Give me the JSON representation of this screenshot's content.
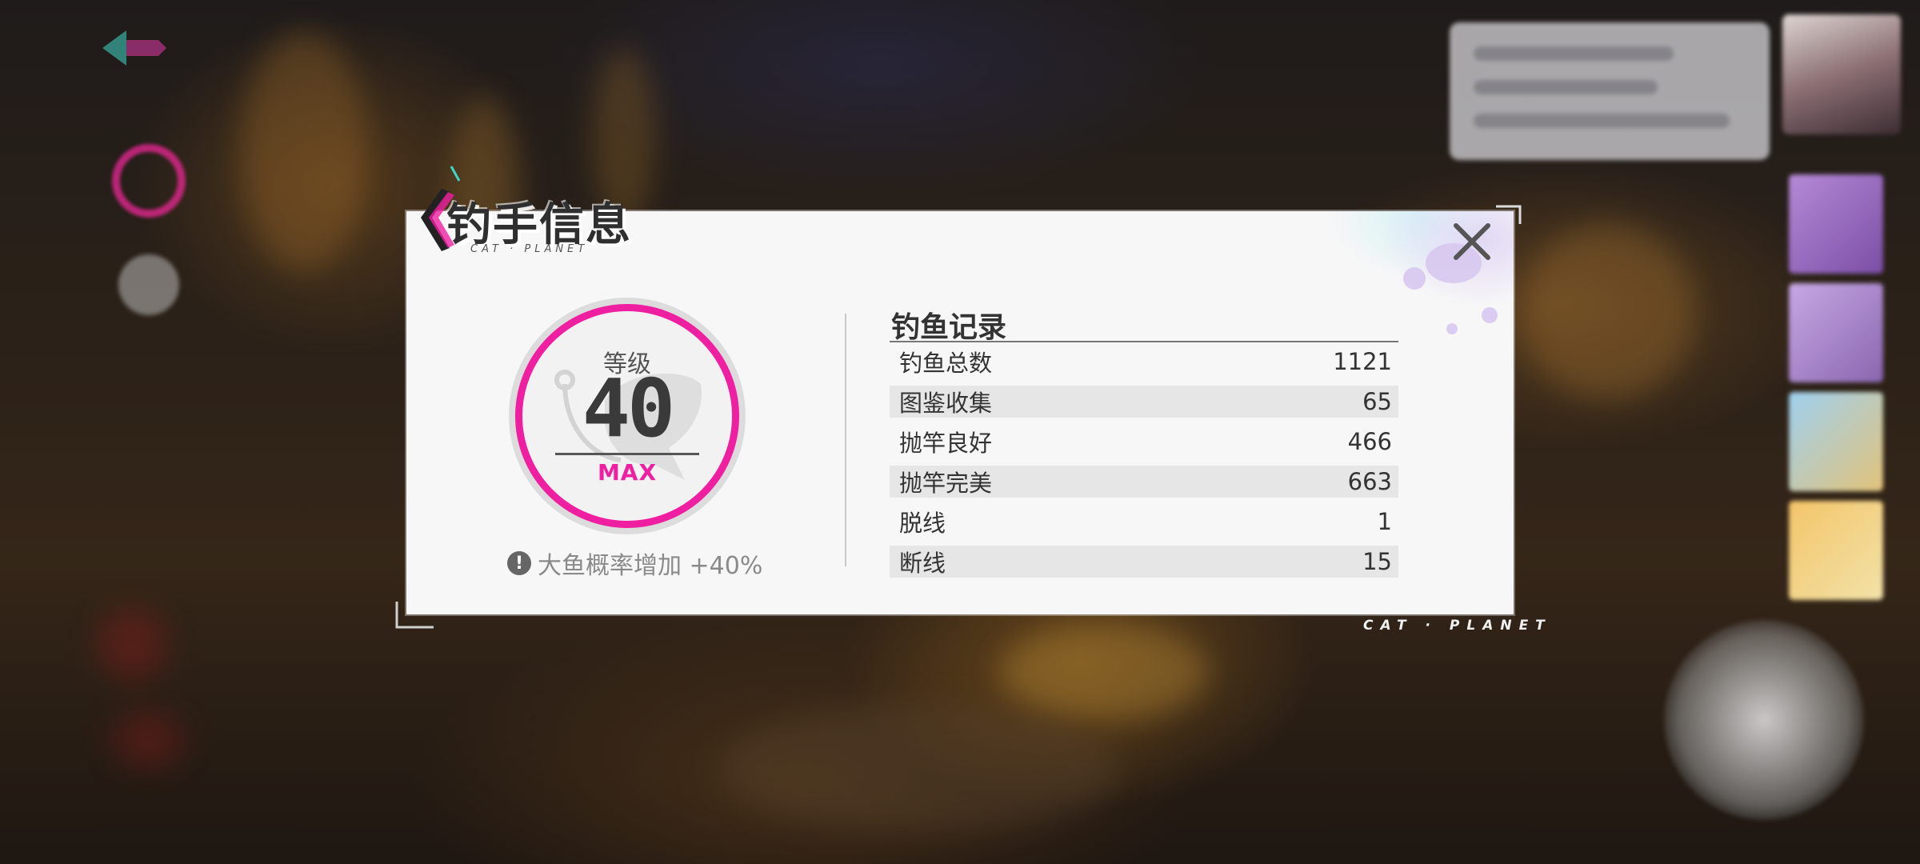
{
  "modal": {
    "title": "钓手信息",
    "brand": "CAT · PLANET",
    "footer_brand": "CAT · PLANET"
  },
  "level": {
    "caption": "等级",
    "value": "40",
    "status": "MAX",
    "bonus_text": "大鱼概率增加 +40%",
    "bonus_icon": "alert-icon"
  },
  "records": {
    "title": "钓鱼记录",
    "rows": [
      {
        "label": "钓鱼总数",
        "value": "1121"
      },
      {
        "label": "图鉴收集",
        "value": "65"
      },
      {
        "label": "抛竿良好",
        "value": "466"
      },
      {
        "label": "抛竿完美",
        "value": "663"
      },
      {
        "label": "脱线",
        "value": "1"
      },
      {
        "label": "断线",
        "value": "15"
      }
    ]
  },
  "colors": {
    "accent_pink": "#ee1fa1",
    "panel_bg": "#f7f7f7",
    "row_alt": "#e6e6e6"
  }
}
